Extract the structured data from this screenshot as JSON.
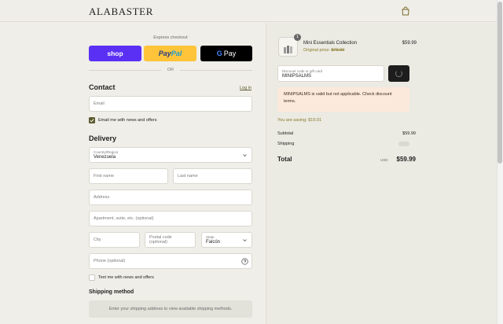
{
  "header": {
    "brand": "ALABASTER",
    "cart_icon": "shopping-bag-icon"
  },
  "express": {
    "label": "Express checkout",
    "shop_label": "shop",
    "paypal_pay": "Pay",
    "paypal_pal": "Pal",
    "gpay_g": "G",
    "gpay_label": "Pay",
    "or": "OR"
  },
  "contact": {
    "heading": "Contact",
    "login_link": "Log in",
    "email_placeholder": "Email",
    "email_news_label": "Email me with news and offers",
    "email_news_checked": true
  },
  "delivery": {
    "heading": "Delivery",
    "country_label": "Country/Region",
    "country_value": "Venezuela",
    "first_name": "First name",
    "last_name": "Last name",
    "address": "Address",
    "apartment": "Apartment, suite, etc. (optional)",
    "city": "City",
    "postal": "Postal code (optional)",
    "state_label": "State",
    "state_value": "Falcón",
    "phone": "Phone (optional)",
    "text_news_label": "Text me with news and offers",
    "text_news_checked": false
  },
  "shipping": {
    "heading": "Shipping method",
    "message": "Enter your shipping address to view available shipping methods."
  },
  "summary": {
    "quantity": "1",
    "product_name": "Mini Essentials Collection",
    "original_label": "Original price:",
    "original_price": "$79.00",
    "product_price": "$59.99",
    "discount_label": "Discount code or gift card",
    "discount_value": "MINIPSALMS",
    "alert": "MINIPSALMS is valid but not applicable. Check discount terms.",
    "saving": "You are saving: $19.01",
    "subtotal_label": "Subtotal",
    "subtotal_value": "$59.99",
    "shipping_label": "Shipping",
    "total_label": "Total",
    "currency": "USD",
    "total_value": "$59.99"
  },
  "colors": {
    "background": "#efeee8",
    "shop_pay": "#5a31f4",
    "paypal": "#ffc439",
    "accent": "#5c5a2e",
    "alert_bg": "#fbe9dc"
  }
}
